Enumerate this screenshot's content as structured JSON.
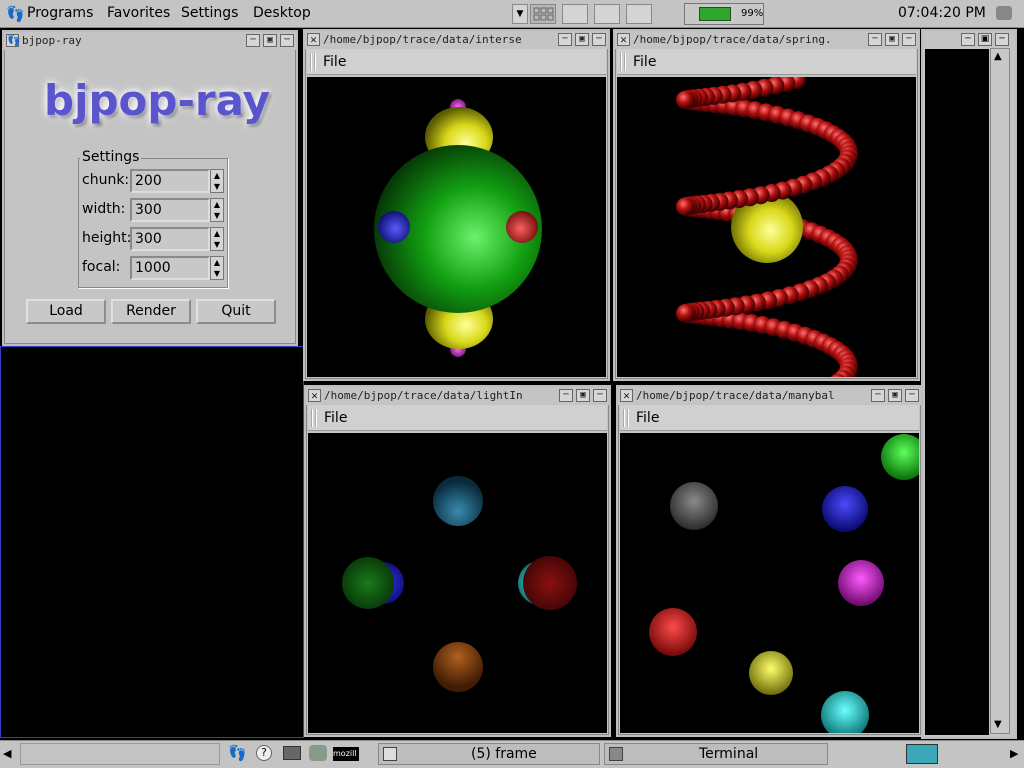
{
  "top_panel": {
    "menu": [
      "Programs",
      "Favorites",
      "Settings",
      "Desktop"
    ],
    "battery_pct": "99%",
    "clock": "07:04:20 PM"
  },
  "win_control": {
    "title": "bjpop-ray",
    "logo": "bjpop-ray",
    "settings_legend": "Settings",
    "fields": [
      {
        "label": "chunk:",
        "value": "200"
      },
      {
        "label": "width:",
        "value": "300"
      },
      {
        "label": "height:",
        "value": "300"
      },
      {
        "label": "focal:",
        "value": "1000"
      }
    ],
    "buttons": [
      "Load",
      "Render",
      "Quit"
    ]
  },
  "viewers": [
    {
      "title": "/home/bjpop/trace/data/interse",
      "menu": "File"
    },
    {
      "title": "/home/bjpop/trace/data/spring.",
      "menu": "File"
    },
    {
      "title": "/home/bjpop/trace/data/lightIn",
      "menu": "File"
    },
    {
      "title": "/home/bjpop/trace/data/manybal",
      "menu": "File"
    }
  ],
  "taskbar": {
    "mini_label": "mozill",
    "tasks": [
      "(5) frame",
      "Terminal"
    ]
  },
  "colors": {
    "panel": "#c4c4c4",
    "desktop": "#000000",
    "logo": "#5a55cc"
  }
}
